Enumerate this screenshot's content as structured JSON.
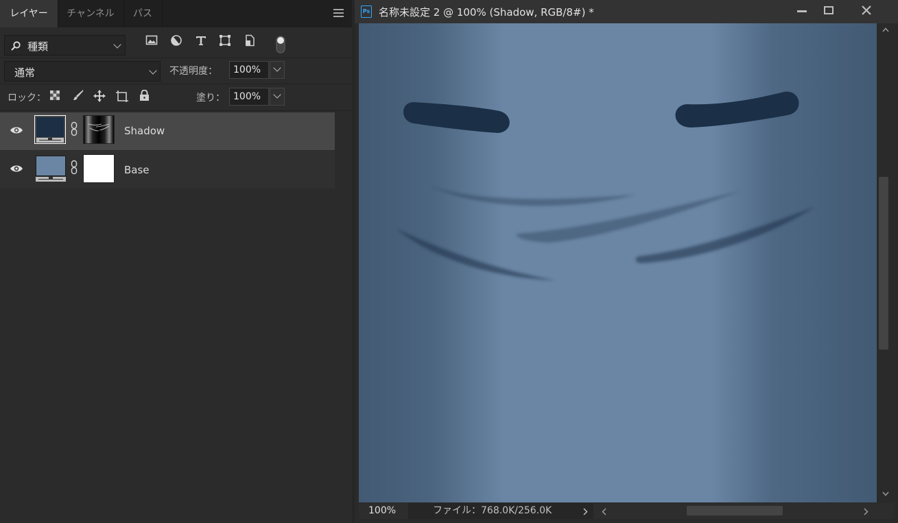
{
  "layers_panel": {
    "tabs": [
      {
        "label": "レイヤー",
        "active": true
      },
      {
        "label": "チャンネル",
        "active": false
      },
      {
        "label": "パス",
        "active": false
      }
    ],
    "filter": {
      "value": "種類",
      "icon": "search-icon"
    },
    "filter_icons": [
      "image-filter-icon",
      "adjustment-filter-icon",
      "type-filter-icon",
      "shape-filter-icon",
      "smart-object-filter-icon",
      "filter-toggle-icon"
    ],
    "blend_mode": "通常",
    "opacity_label": "不透明度：",
    "opacity_value": "100%",
    "lock_label": "ロック：",
    "lock_icons": [
      "lock-transparent-pixels-icon",
      "lock-image-pixels-icon",
      "lock-position-icon",
      "lock-artboard-icon",
      "lock-all-icon"
    ],
    "fill_label": "塗り：",
    "fill_value": "100%",
    "layers": [
      {
        "name": "Shadow",
        "selected": true,
        "visible": true,
        "color": "#1c2f44",
        "mask": "gradient"
      },
      {
        "name": "Base",
        "selected": false,
        "visible": true,
        "color": "#6a86a4",
        "mask": "white"
      }
    ]
  },
  "document": {
    "title": "名称未設定 2 @ 100% (Shadow, RGB/8#) *",
    "zoom": "100%",
    "file_info": "ファイル：768.0K/256.0K",
    "canvas_colors": {
      "base": "#6a86a4",
      "edge": "#425a73",
      "stroke": "#1b2f46"
    }
  }
}
